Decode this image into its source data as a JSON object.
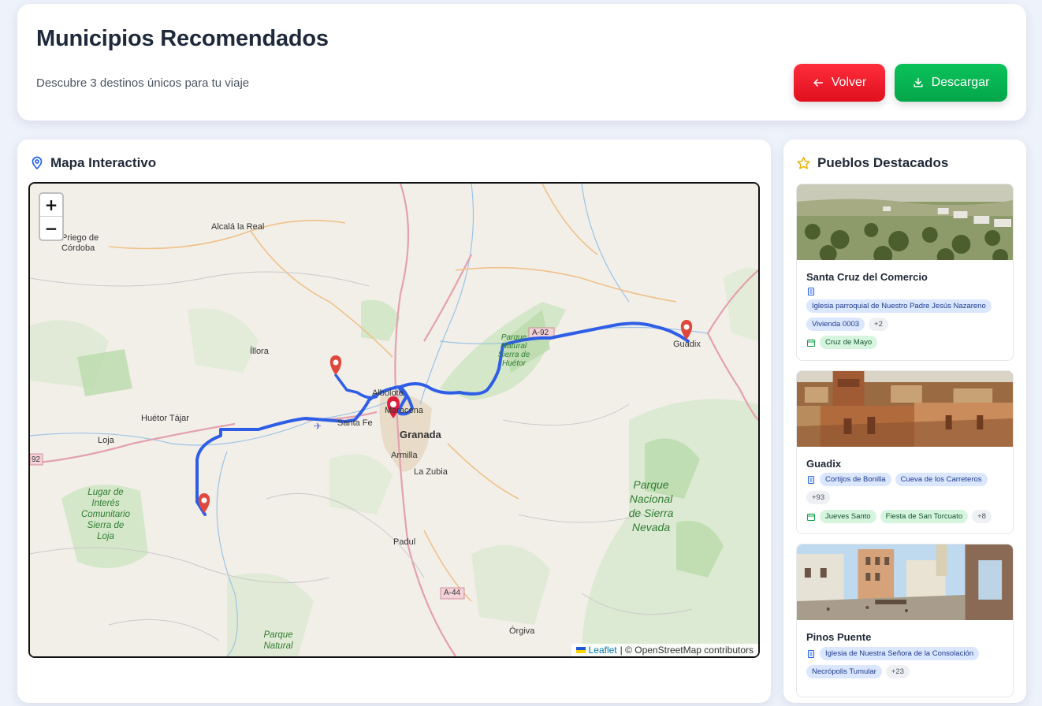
{
  "header": {
    "title": "Municipios Recomendados",
    "subtitle": "Descubre 3 destinos únicos para tu viaje",
    "back_label": "Volver",
    "download_label": "Descargar",
    "back_color": "#ff1f2f",
    "download_color": "#07b653"
  },
  "map_panel": {
    "title": "Mapa Interactivo",
    "zoom_in": "+",
    "zoom_out": "−",
    "attribution_link": "Leaflet",
    "attribution_text": "| © OpenStreetMap contributors",
    "labels": {
      "priego": "Priego de",
      "cordoba": "Córdoba",
      "alcala": "Alcalá la Real",
      "illora": "Íllora",
      "huetor": "Huétor Tájar",
      "loja": "Loja",
      "santafe": "Santa Fe",
      "albolote": "Albolote",
      "maracena": "Maracena",
      "granada": "Granada",
      "armilla": "Armilla",
      "zubia": "La Zubia",
      "padul": "Padul",
      "orgiva": "Órgiva",
      "guadix": "Guadix",
      "a92": "A-92",
      "a92b": "92",
      "a44": "A-44",
      "pn_huetor_1": "Parque",
      "pn_huetor_2": "Natural",
      "pn_huetor_3": "Sierra de",
      "pn_huetor_4": "Huétor",
      "loja_1": "Lugar de",
      "loja_2": "Interés",
      "loja_3": "Comunitario",
      "loja_4": "Sierra de",
      "loja_5": "Loja",
      "sn_1": "Parque",
      "sn_2": "Nacional",
      "sn_3": "de Sierra",
      "sn_4": "Nevada",
      "pn_bottom_1": "Parque",
      "pn_bottom_2": "Natural"
    }
  },
  "side_panel": {
    "title": "Pueblos Destacados",
    "towns": [
      {
        "name": "Santa Cruz del Comercio",
        "monuments": [
          "Iglesia parroquial de Nuestro Padre Jesús Nazareno",
          "Vivienda 0003"
        ],
        "monuments_more": "+2",
        "festivals": [
          "Cruz de Mayo"
        ]
      },
      {
        "name": "Guadix",
        "monuments": [
          "Cortijos de Bonilla",
          "Cueva de los Carreteros"
        ],
        "monuments_more": "+93",
        "festivals": [
          "Jueves Santo",
          "Fiesta de San Torcuato"
        ],
        "festivals_more": "+8"
      },
      {
        "name": "Pinos Puente",
        "monuments": [
          "Iglesia de Nuestra Señora de la Consolación",
          "Necrópolis Tumular"
        ],
        "monuments_more": "+23"
      }
    ]
  }
}
